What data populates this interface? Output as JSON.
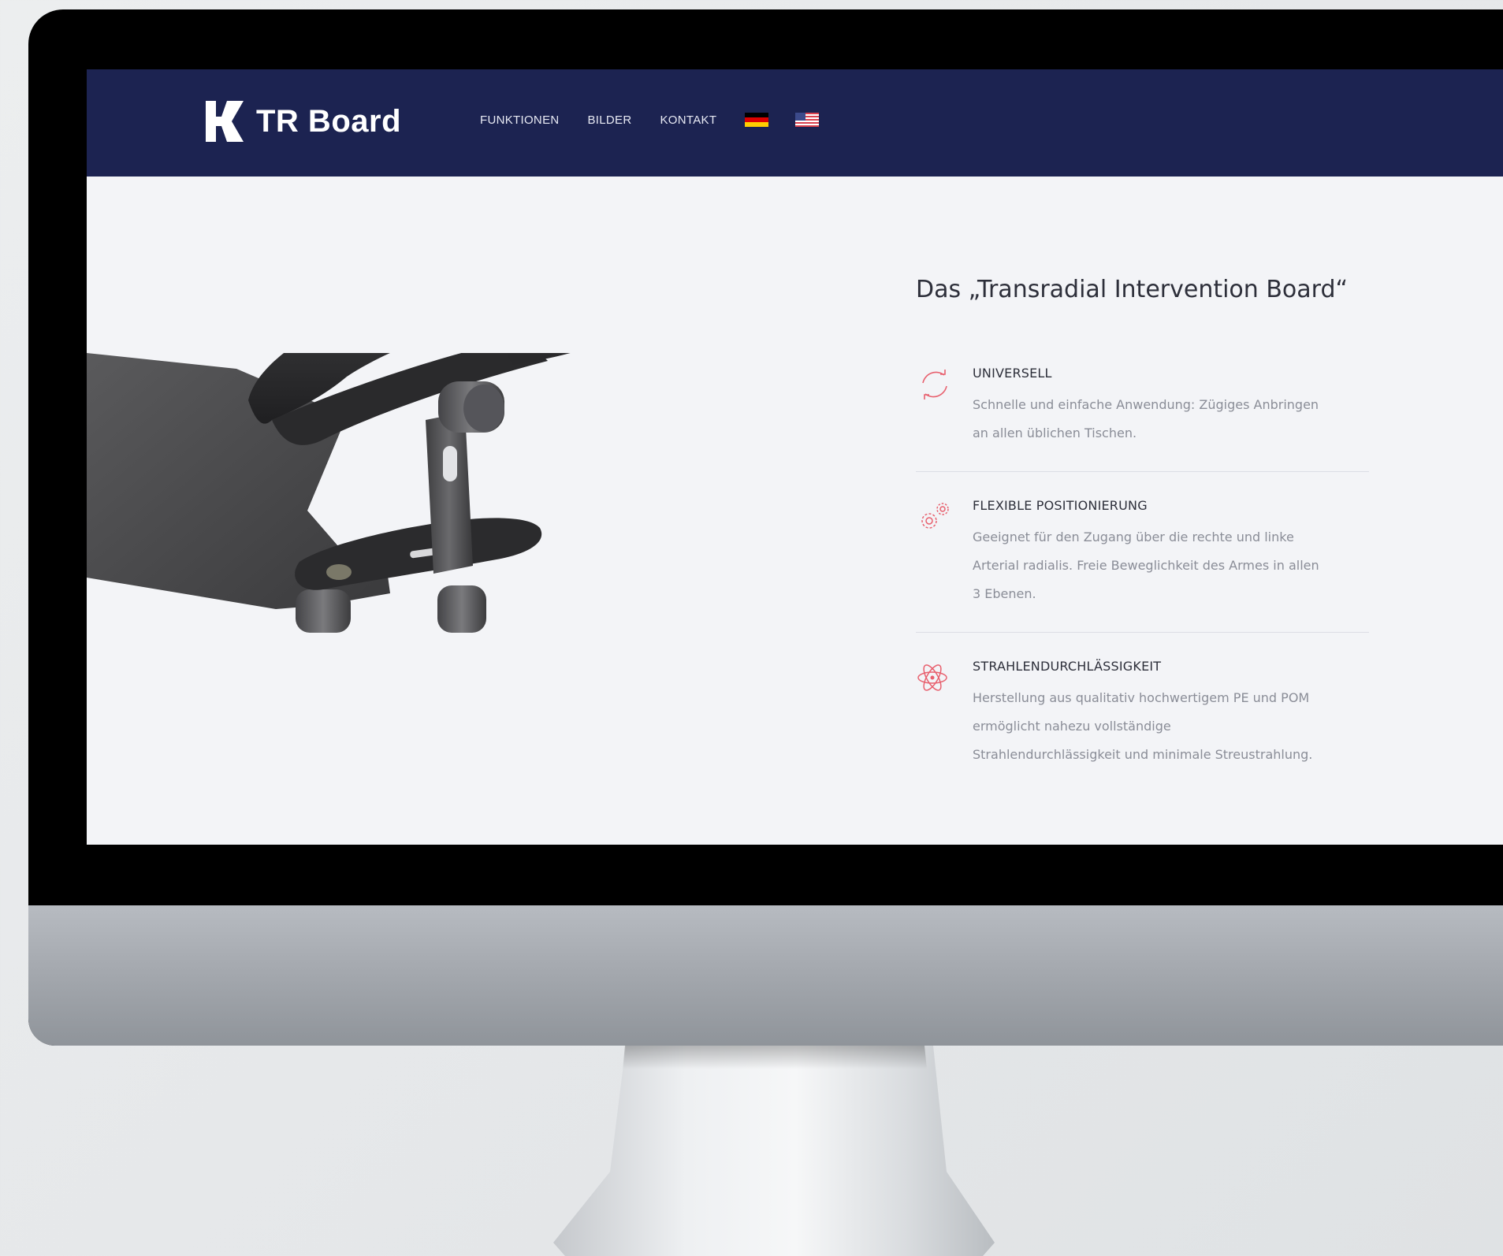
{
  "header": {
    "brand": "TR Board",
    "nav": [
      {
        "label": "FUNKTIONEN"
      },
      {
        "label": "BILDER"
      },
      {
        "label": "KONTAKT"
      }
    ],
    "languages": [
      "german-flag-icon",
      "us-flag-icon"
    ]
  },
  "main": {
    "headline": "Das „Transradial Intervention Board“",
    "features": [
      {
        "icon": "refresh-icon",
        "title": "UNIVERSELL",
        "description": "Schnelle und einfache Anwendung: Zügiges Anbringen an allen üblichen Tischen."
      },
      {
        "icon": "gears-icon",
        "title": "FLEXIBLE POSITIONIERUNG",
        "description": "Geeignet für den Zugang über die rechte und linke Arterial radialis. Freie Beweglichkeit des Armes in allen 3 Ebenen."
      },
      {
        "icon": "atom-icon",
        "title": "STRAHLENDURCHLÄSSIGKEIT",
        "description": "Herstellung aus qualitativ hochwertigem PE und POM ermöglicht nahezu vollständige Strahlendurchlässigkeit und minimale Streustrahlung."
      }
    ]
  },
  "colors": {
    "navbar": "#1c2351",
    "accent": "#e8606e",
    "background": "#f3f4f7"
  }
}
